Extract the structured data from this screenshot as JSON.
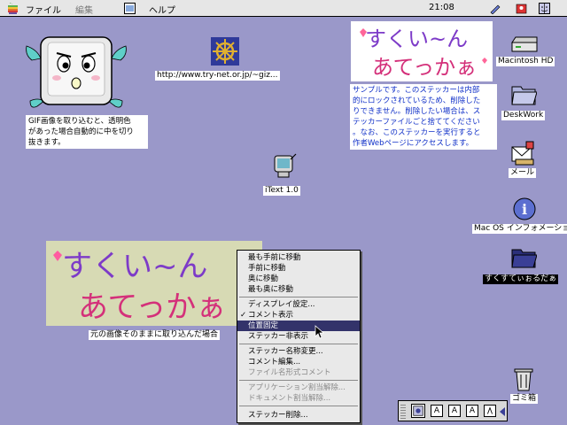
{
  "menubar": {
    "file": "ファイル",
    "edit": "編集",
    "help": "ヘルプ",
    "clock": "21:08"
  },
  "desktop": {
    "gif_note": [
      "GIF画像を取り込むと、透明色",
      "があった場合自動的に中を切り",
      "抜きます。"
    ],
    "url_label": "http://www.try-net.or.jp/~giz...",
    "sample_note": [
      "サンプルです。このステッカーは内部",
      "的にロックされているため、削除した",
      "りできません。削除したい場合は、ス",
      "テッカーファイルごと捨ててください",
      "。なお、このステッカーを実行すると",
      "作者Webページにアクセスします。"
    ],
    "itext_label": "iText 1.0",
    "sticker_caption": "元の画像そのままに取り込んだ場合",
    "sticker_title_1": "すくい~ん",
    "sticker_title_2": "あてっかぁ",
    "icons": {
      "macintosh_hd": "Macintosh HD",
      "deskwork": "DeskWork",
      "mail": "メール",
      "macos_info": "Mac OS インフォメーション",
      "folder_label": "すくすてぃぉるだぁ",
      "trash": "ゴミ箱"
    }
  },
  "context_menu": {
    "items": [
      "最も手前に移動",
      "手前に移動",
      "奥に移動",
      "最も奥に移動",
      "ディスプレイ設定...",
      "コメント表示",
      "位置固定",
      "ステッカー非表示",
      "ステッカー名称変更...",
      "コメント編集...",
      "ファイル名形式コメント",
      "アプリケーション割当解除...",
      "ドキュメント割当解除...",
      "ステッカー削除..."
    ],
    "check_mark": "✓"
  },
  "palette": {
    "buttons": [
      "A",
      "A",
      "A"
    ]
  }
}
